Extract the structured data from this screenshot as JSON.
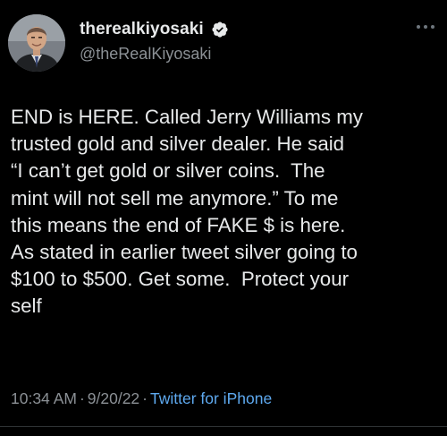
{
  "user": {
    "display_name": "therealkiyosaki",
    "handle": "@theRealKiyosaki",
    "verified": true,
    "avatar_icon": "profile-photo"
  },
  "tweet": {
    "text": "END is HERE. Called Jerry Williams my\ntrusted gold and silver dealer. He said\n“I can’t get gold or silver coins.  The\nmint will not sell me anymore.” To me\nthis means the end of FAKE $ is here.\nAs stated in earlier tweet silver going to\n$100 to $500. Get some.  Protect your\nself",
    "time": "10:34 AM",
    "date": "9/20/22",
    "separator": "·",
    "source": "Twitter for iPhone"
  },
  "icons": {
    "verified": "verified-badge-icon",
    "more": "more-options-icon"
  },
  "colors": {
    "background": "#000000",
    "text": "#e7e9ea",
    "muted": "#8b9095",
    "link": "#5ea9ef"
  }
}
